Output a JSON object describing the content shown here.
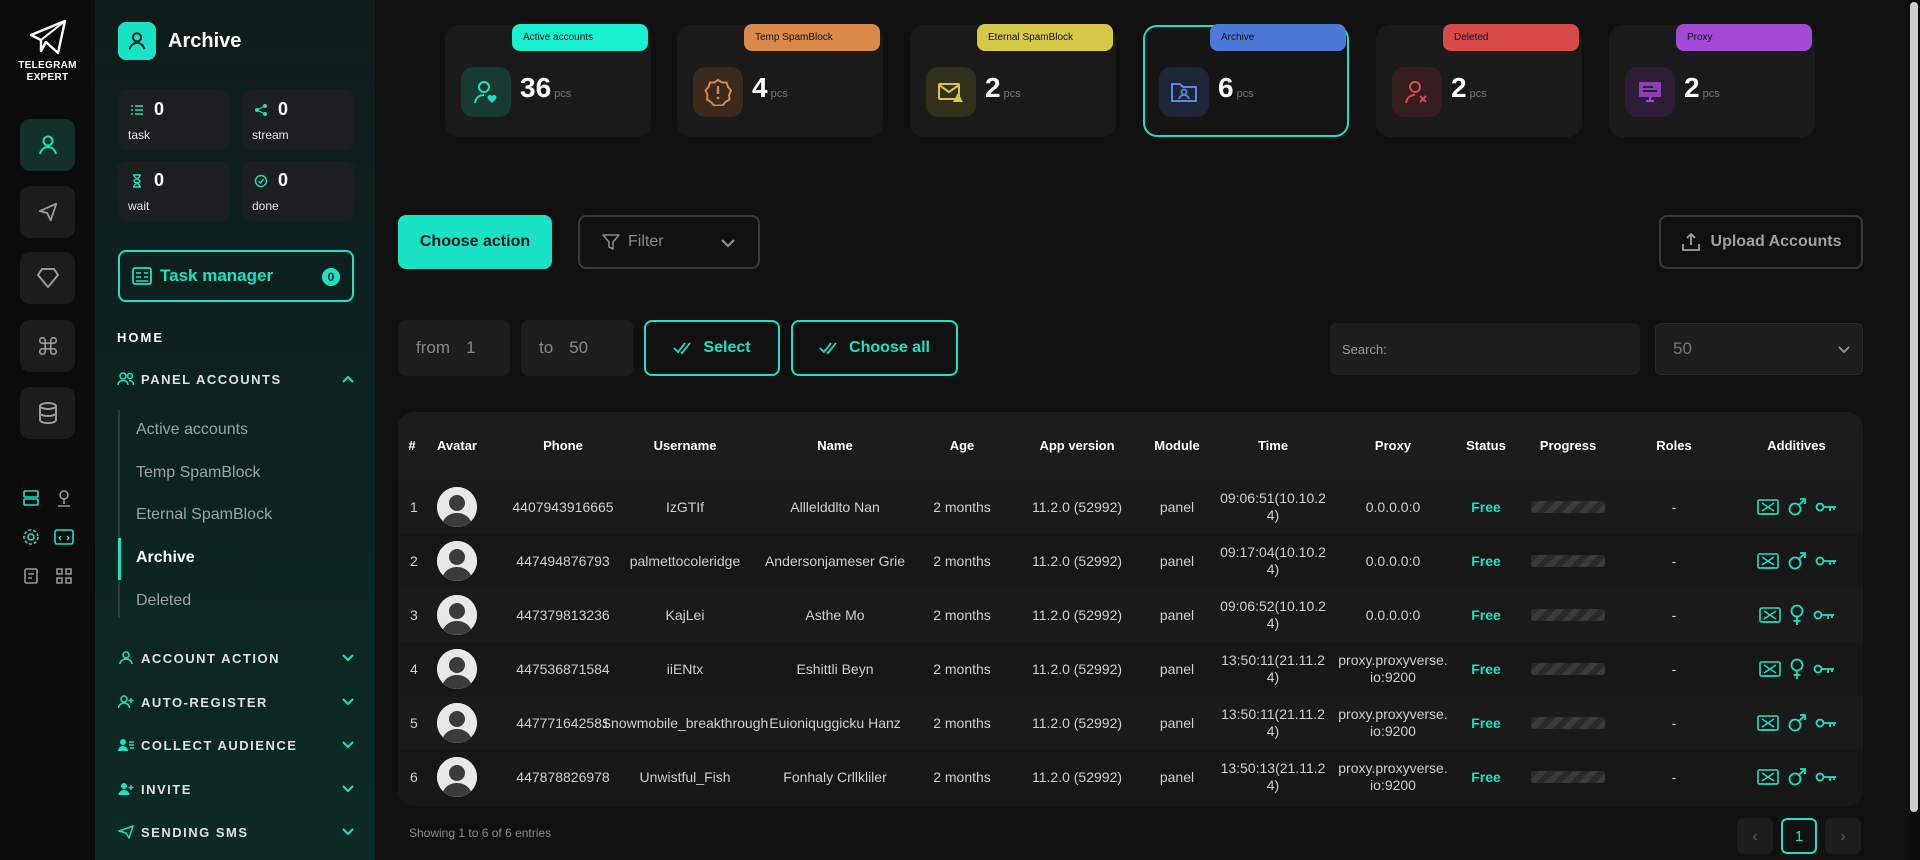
{
  "brand": {
    "name_line1": "TELEGRAM",
    "name_line2": "EXPERT"
  },
  "sidebar": {
    "title": "Archive",
    "stats": [
      {
        "value": "0",
        "label": "task"
      },
      {
        "value": "0",
        "label": "stream"
      },
      {
        "value": "0",
        "label": "wait"
      },
      {
        "value": "0",
        "label": "done"
      }
    ],
    "task_manager": {
      "label": "Task manager",
      "count": "0"
    },
    "home_label": "HOME",
    "panel_accounts": "PANEL ACCOUNTS",
    "sub_items": [
      "Active accounts",
      "Temp SpamBlock",
      "Eternal SpamBlock",
      "Archive",
      "Deleted"
    ],
    "sections": [
      "ACCOUNT ACTION",
      "AUTO-REGISTER",
      "COLLECT AUDIENCE",
      "INVITE",
      "SENDING SMS"
    ]
  },
  "cards": [
    {
      "tag": "Active accounts",
      "value": "36",
      "unit": "pcs",
      "color": "#19f0cf"
    },
    {
      "tag": "Temp SpamBlock",
      "value": "4",
      "unit": "pcs",
      "color": "#d98a4a"
    },
    {
      "tag": "Eternal SpamBlock",
      "value": "2",
      "unit": "pcs",
      "color": "#d6c94a"
    },
    {
      "tag": "Archive",
      "value": "6",
      "unit": "pcs",
      "color": "#4d7ad8"
    },
    {
      "tag": "Deleted",
      "value": "2",
      "unit": "pcs",
      "color": "#d64a4a"
    },
    {
      "tag": "Proxy",
      "value": "2",
      "unit": "pcs",
      "color": "#a24ad6"
    }
  ],
  "toolbar": {
    "choose_action": "Choose action",
    "filter": "Filter",
    "upload": "Upload Accounts",
    "from_label": "from",
    "from_value": "1",
    "to_label": "to",
    "to_value": "50",
    "select": "Select",
    "choose_all": "Choose all",
    "search_placeholder": "Search:",
    "per_page": "50"
  },
  "table": {
    "headers": [
      "#",
      "Avatar",
      "Phone",
      "Username",
      "Name",
      "Age",
      "App version",
      "Module",
      "Time",
      "Proxy",
      "Status",
      "Progress",
      "Roles",
      "Additives"
    ],
    "rows": [
      {
        "n": "1",
        "phone": "4407943916665",
        "username": "IzGTIf",
        "name": "Alllelddlto Nan",
        "age": "2 months",
        "app": "11.2.0 (52992)",
        "module": "panel",
        "time": "09:06:51(10.10.24)",
        "proxy": "0.0.0.0:0",
        "status": "Free",
        "roles": "-",
        "gender": "male"
      },
      {
        "n": "2",
        "phone": "447494876793",
        "username": "palmettocoleridge",
        "name": "Andersonjameser Grie",
        "age": "2 months",
        "app": "11.2.0 (52992)",
        "module": "panel",
        "time": "09:17:04(10.10.24)",
        "proxy": "0.0.0.0:0",
        "status": "Free",
        "roles": "-",
        "gender": "male"
      },
      {
        "n": "3",
        "phone": "447379813236",
        "username": "KajLei",
        "name": "Asthe Mo",
        "age": "2 months",
        "app": "11.2.0 (52992)",
        "module": "panel",
        "time": "09:06:52(10.10.24)",
        "proxy": "0.0.0.0:0",
        "status": "Free",
        "roles": "-",
        "gender": "female"
      },
      {
        "n": "4",
        "phone": "447536871584",
        "username": "iiENtx",
        "name": "Eshittli Beyn",
        "age": "2 months",
        "app": "11.2.0 (52992)",
        "module": "panel",
        "time": "13:50:11(21.11.24)",
        "proxy": "proxy.proxyverse.io:9200",
        "status": "Free",
        "roles": "-",
        "gender": "female"
      },
      {
        "n": "5",
        "phone": "447771642581",
        "username": "Snowmobile_breakthrough",
        "name": "Euioniquggicku Hanz",
        "age": "2 months",
        "app": "11.2.0 (52992)",
        "module": "panel",
        "time": "13:50:11(21.11.24)",
        "proxy": "proxy.proxyverse.io:9200",
        "status": "Free",
        "roles": "-",
        "gender": "male"
      },
      {
        "n": "6",
        "phone": "447878826978",
        "username": "Unwistful_Fish",
        "name": "Fonhaly Crllkliler",
        "age": "2 months",
        "app": "11.2.0 (52992)",
        "module": "panel",
        "time": "13:50:13(21.11.24)",
        "proxy": "proxy.proxyverse.io:9200",
        "status": "Free",
        "roles": "-",
        "gender": "male"
      }
    ]
  },
  "footer": {
    "info": "Showing 1 to 6 of 6 entries",
    "page": "1",
    "prev": "‹",
    "next": "›"
  },
  "colors": {
    "accent": "#19e3c4"
  }
}
